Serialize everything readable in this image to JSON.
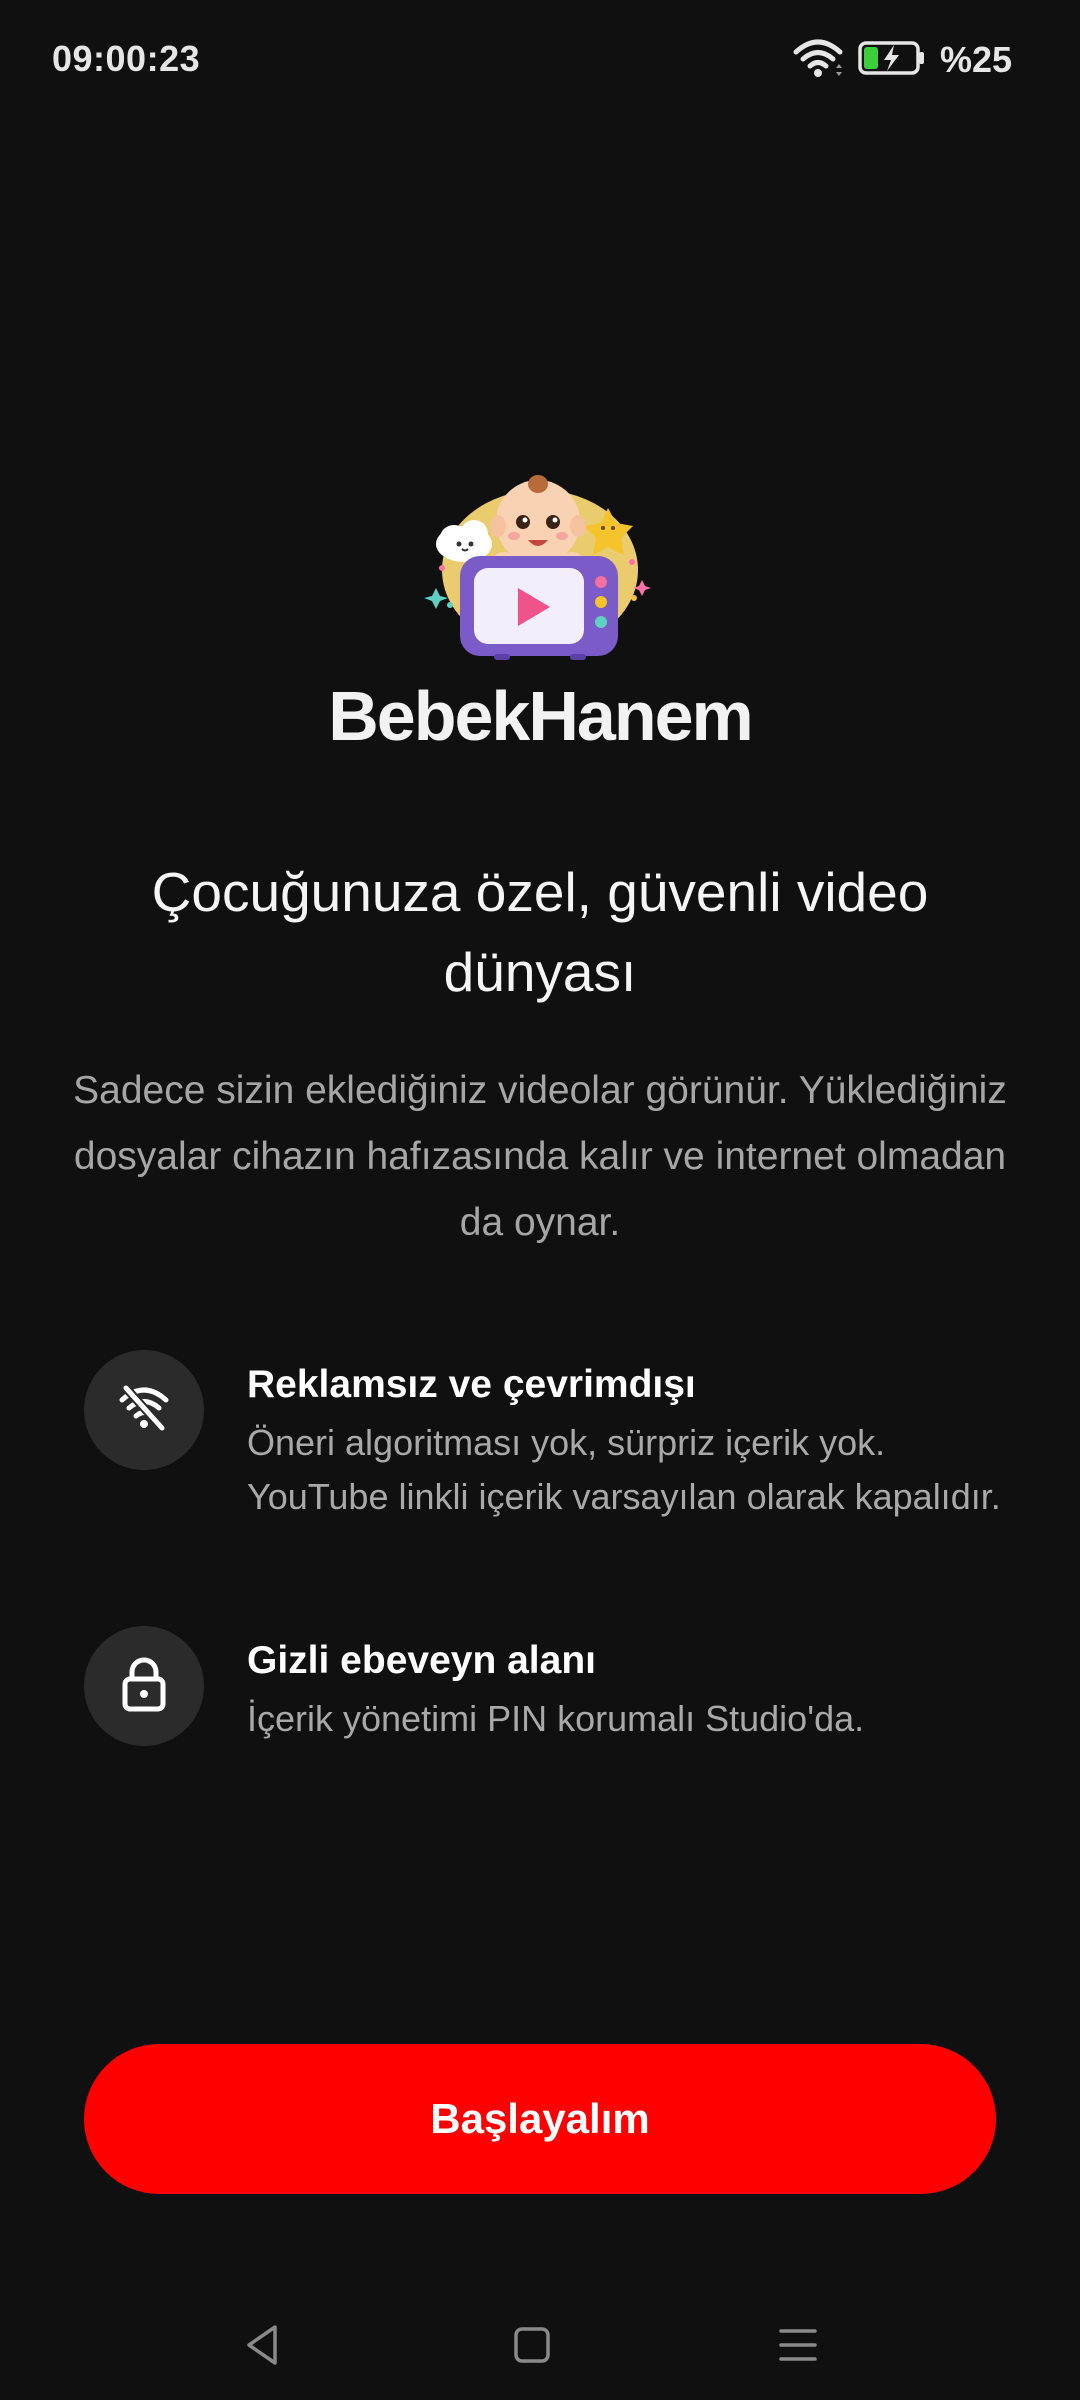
{
  "status_bar": {
    "time": "09:00:23",
    "battery_percent": "%25",
    "icons": [
      "wifi-icon",
      "battery-charging-icon"
    ]
  },
  "app": {
    "name": "BebekHanem",
    "logo_icon": "baby-tv-logo"
  },
  "intro": {
    "headline": "Çocuğunuza özel, güvenli video dünyası",
    "description": "Sadece sizin eklediğiniz videolar görünür. Yüklediğiniz dosyalar cihazın hafızasında kalır ve internet olmadan da oynar."
  },
  "features": [
    {
      "icon": "wifi-off-icon",
      "title": "Reklamsız ve çevrimdışı",
      "description": "Öneri algoritması yok, sürpriz içerik yok. YouTube linkli içerik varsayılan olarak kapalıdır."
    },
    {
      "icon": "lock-icon",
      "title": "Gizli ebeveyn alanı",
      "description": "İçerik yönetimi PIN korumalı Studio'da."
    }
  ],
  "actions": {
    "start_label": "Başlayalım"
  },
  "colors": {
    "background": "#101010",
    "accent": "#ff0000",
    "icon_circle": "#2b2b2b"
  },
  "navigation": {
    "buttons": [
      "back-icon",
      "home-icon",
      "menu-icon"
    ]
  }
}
